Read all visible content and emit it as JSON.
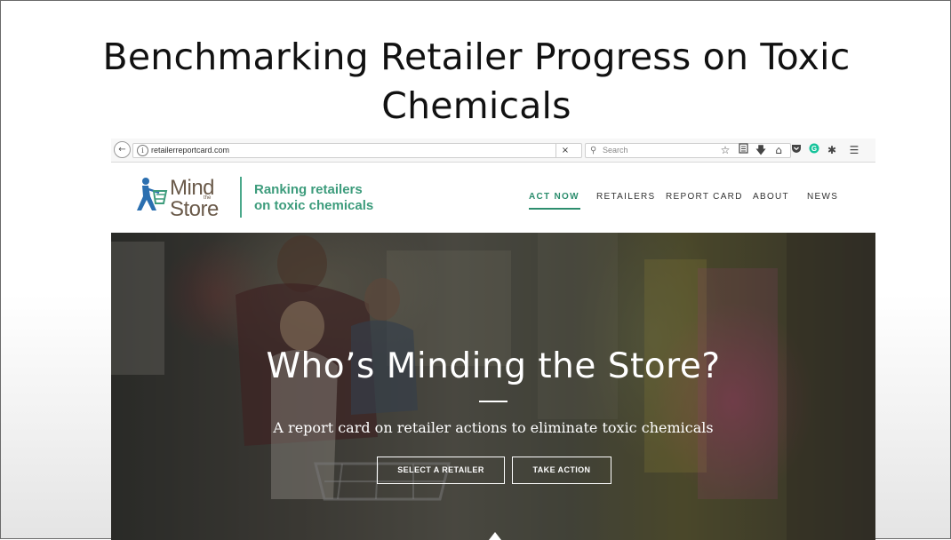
{
  "slide": {
    "title_line1": "Benchmarking Retailer Progress on Toxic",
    "title_line2": "Chemicals"
  },
  "browser": {
    "url": "retailerreportcard.com",
    "search_placeholder": "Search",
    "clear_glyph": "×",
    "toolbar_icons": [
      "bookmark-star-icon",
      "reading-list-icon",
      "download-icon",
      "home-icon",
      "pocket-icon",
      "grammarly-icon",
      "extension-icon",
      "menu-icon"
    ]
  },
  "site": {
    "logo": {
      "word1": "Mind",
      "word2": "the",
      "word3": "Store"
    },
    "tagline_line1": "Ranking retailers",
    "tagline_line2": "on toxic chemicals",
    "nav": [
      "ACT NOW",
      "RETAILERS",
      "REPORT CARD",
      "ABOUT",
      "NEWS"
    ],
    "active_nav": "ACT NOW",
    "accent_color": "#2d8e6e"
  },
  "hero": {
    "title": "Who’s Minding the Store?",
    "subtitle": "A report card on retailer actions to eliminate toxic chemicals",
    "buttons": [
      "SELECT A RETAILER",
      "TAKE ACTION"
    ]
  }
}
